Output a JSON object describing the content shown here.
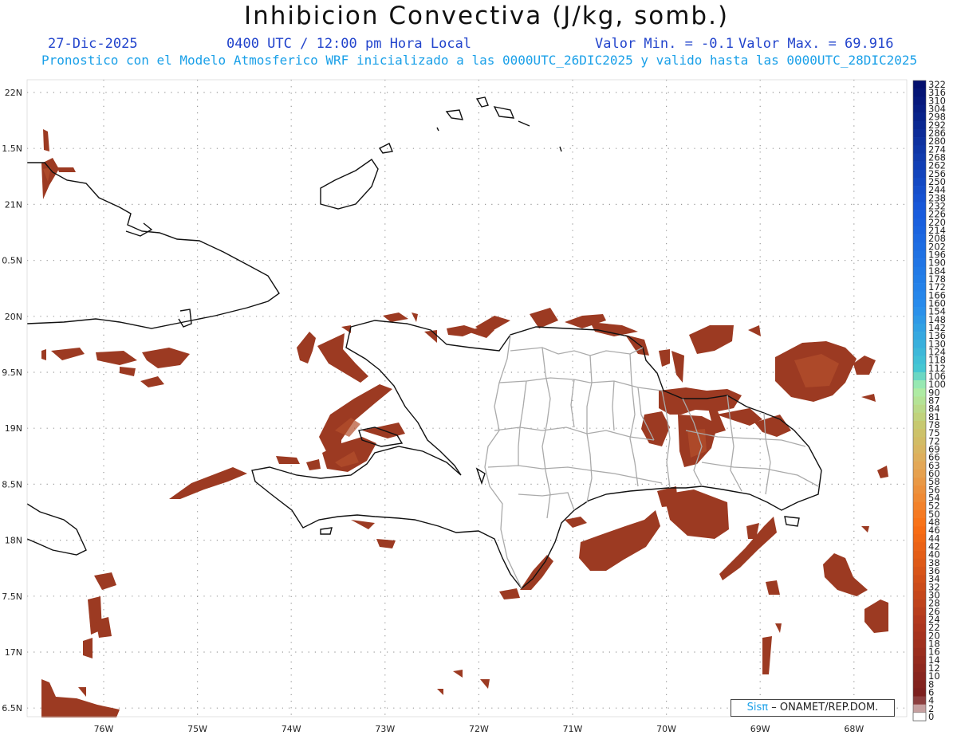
{
  "header": {
    "title": "Inhibicion Convectiva (J/kg, somb.)",
    "date": "27-Dic-2025",
    "time": "0400 UTC / 12:00 pm Hora Local",
    "vmin": "Valor Min. = -0.1",
    "vmax": "Valor Max. = 69.916",
    "forecast": "Pronostico con el Modelo Atmosferico WRF inicializado a las 0000UTC_26DIC2025 y valido hasta las  0000UTC_28DIC2025"
  },
  "axes": {
    "lat_labels": [
      "22N",
      "1.5N",
      "21N",
      "0.5N",
      "20N",
      "9.5N",
      "19N",
      "8.5N",
      "18N",
      "7.5N",
      "17N",
      "6.5N"
    ],
    "lon_labels": [
      "76W",
      "75W",
      "74W",
      "73W",
      "72W",
      "71W",
      "70W",
      "69W",
      "68W"
    ]
  },
  "colorbar": {
    "labels": [
      "322",
      "316",
      "310",
      "304",
      "298",
      "292",
      "286",
      "280",
      "274",
      "268",
      "262",
      "256",
      "250",
      "244",
      "238",
      "232",
      "226",
      "220",
      "214",
      "208",
      "202",
      "196",
      "190",
      "184",
      "178",
      "172",
      "166",
      "160",
      "154",
      "148",
      "142",
      "136",
      "130",
      "124",
      "118",
      "112",
      "106",
      "100",
      "90",
      "87",
      "84",
      "81",
      "78",
      "75",
      "72",
      "69",
      "66",
      "63",
      "60",
      "58",
      "56",
      "54",
      "52",
      "50",
      "48",
      "46",
      "44",
      "42",
      "40",
      "38",
      "36",
      "34",
      "32",
      "30",
      "28",
      "26",
      "24",
      "22",
      "20",
      "18",
      "16",
      "14",
      "12",
      "10",
      "8",
      "6",
      "4",
      "2",
      "0"
    ]
  },
  "credit": {
    "sis": "Sisπ",
    "rest": "– ONAMET/REP.DOM."
  },
  "colors": {
    "cin_fill": "#9c3a22",
    "cin_fill_light": "#b04a28",
    "coast": "#111111",
    "border": "#aaaaaa"
  }
}
